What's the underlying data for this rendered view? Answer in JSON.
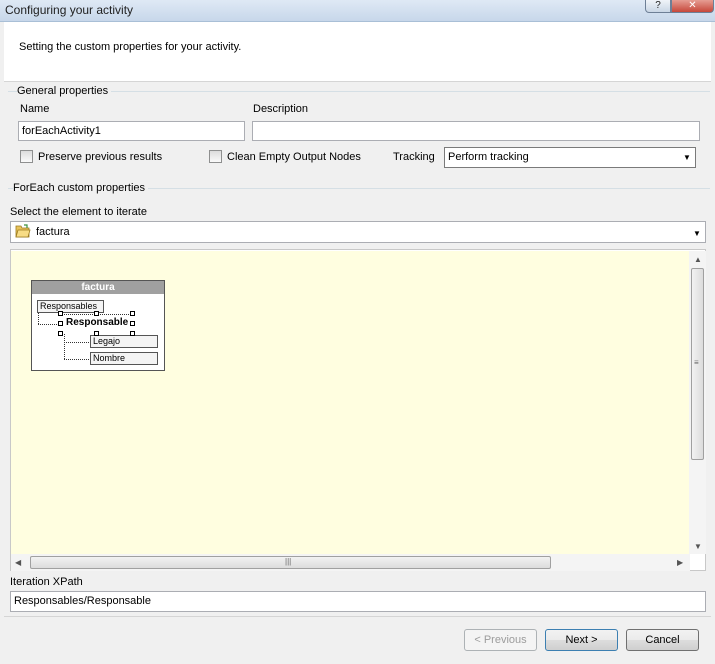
{
  "window": {
    "title": "Configuring your activity",
    "help_label": "?",
    "close_label": "✕"
  },
  "header": {
    "description": "Setting the custom properties for your activity."
  },
  "general": {
    "group_title": "General properties",
    "name_label": "Name",
    "name_value": "forEachActivity1",
    "description_label": "Description",
    "description_value": "",
    "preserve_label": "Preserve previous results",
    "preserve_checked": false,
    "clean_label": "Clean Empty Output Nodes",
    "clean_checked": false,
    "tracking_label": "Tracking",
    "tracking_value": "Perform tracking"
  },
  "foreach": {
    "group_title": "ForEach custom properties",
    "select_label": "Select the element to iterate",
    "selected_element": "factura",
    "element_icon": "folder-open-icon"
  },
  "diagram": {
    "root": "factura",
    "nodes": [
      "Responsables",
      "Responsable",
      "Legajo",
      "Nombre"
    ]
  },
  "xpath": {
    "label": "Iteration XPath",
    "value": "Responsables/Responsable"
  },
  "buttons": {
    "previous": "< Previous",
    "next": "Next >",
    "cancel": "Cancel"
  }
}
